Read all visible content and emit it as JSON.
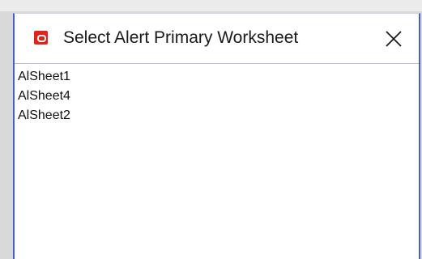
{
  "dialog": {
    "title": "Select Alert Primary Worksheet",
    "app_icon": "oracle-logo-icon",
    "close_icon": "close-icon",
    "accent_color": "#4a5fc4"
  },
  "list": {
    "items": [
      {
        "label": "AlSheet1"
      },
      {
        "label": "AlSheet4"
      },
      {
        "label": "AlSheet2"
      }
    ]
  }
}
